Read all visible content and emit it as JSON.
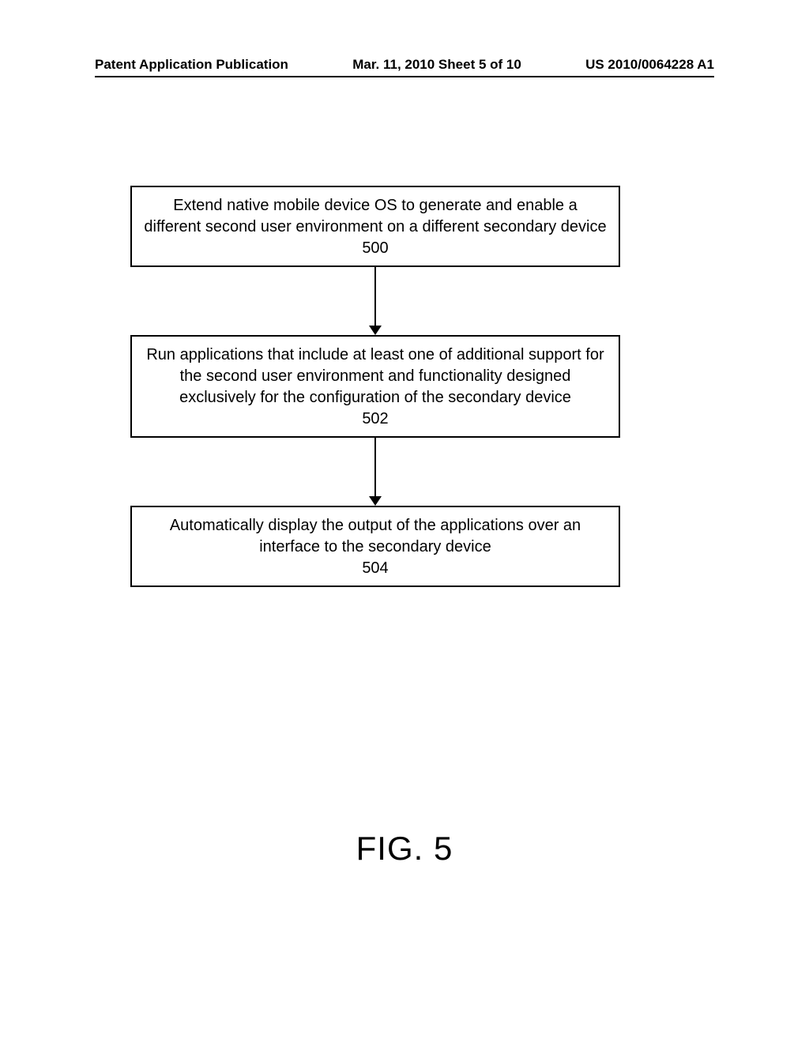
{
  "header": {
    "left": "Patent Application Publication",
    "middle": "Mar. 11, 2010  Sheet 5 of 10",
    "right": "US 2010/0064228 A1"
  },
  "flow": {
    "step1": {
      "text": "Extend native mobile device OS to generate and enable a different second user environment on a different secondary device",
      "ref": "500"
    },
    "step2": {
      "text": "Run applications that include at least one of additional support for the second user environment and functionality designed exclusively for the configuration of the secondary device",
      "ref": "502"
    },
    "step3": {
      "text": "Automatically display the output of the applications over an interface to the secondary device",
      "ref": "504"
    }
  },
  "figure_label": "FIG. 5"
}
